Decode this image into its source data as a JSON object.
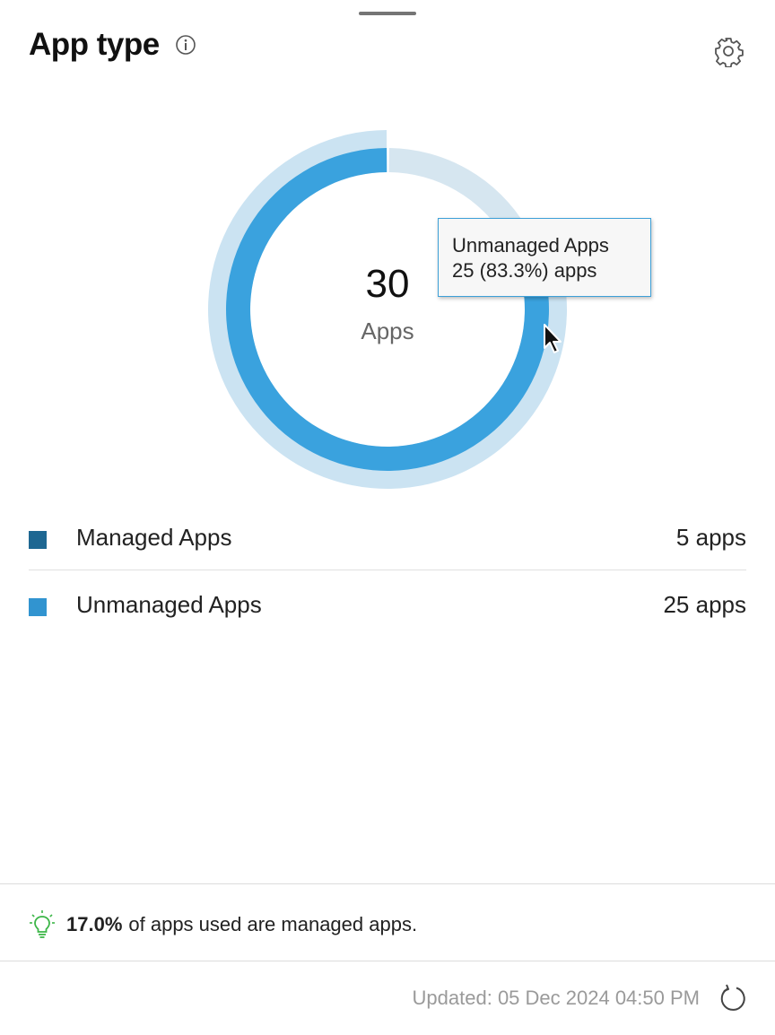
{
  "header": {
    "title": "App type",
    "info_icon": "info-icon",
    "settings_icon": "gear-icon"
  },
  "donut": {
    "total": "30",
    "total_label": "Apps",
    "colors": {
      "managed": "#1e6792",
      "unmanaged": "#3aa2de",
      "managed_track": "#d6e6f0",
      "unmanaged_hover": "#cbe3f2"
    }
  },
  "chart_data": {
    "type": "pie",
    "categories": [
      "Managed Apps",
      "Unmanaged Apps"
    ],
    "values": [
      5,
      25
    ]
  },
  "tooltip": {
    "title": "Unmanaged Apps",
    "detail": "25 (83.3%) apps"
  },
  "legend": [
    {
      "label": "Managed Apps",
      "value": "5 apps",
      "color": "#1e6792"
    },
    {
      "label": "Unmanaged Apps",
      "value": "25 apps",
      "color": "#3194d0"
    }
  ],
  "insight": {
    "icon": "lightbulb-icon",
    "highlight": "17.0%",
    "text": "of apps used are managed apps."
  },
  "footer": {
    "updated": "Updated: 05 Dec 2024 04:50 PM",
    "refresh_icon": "refresh-icon"
  }
}
